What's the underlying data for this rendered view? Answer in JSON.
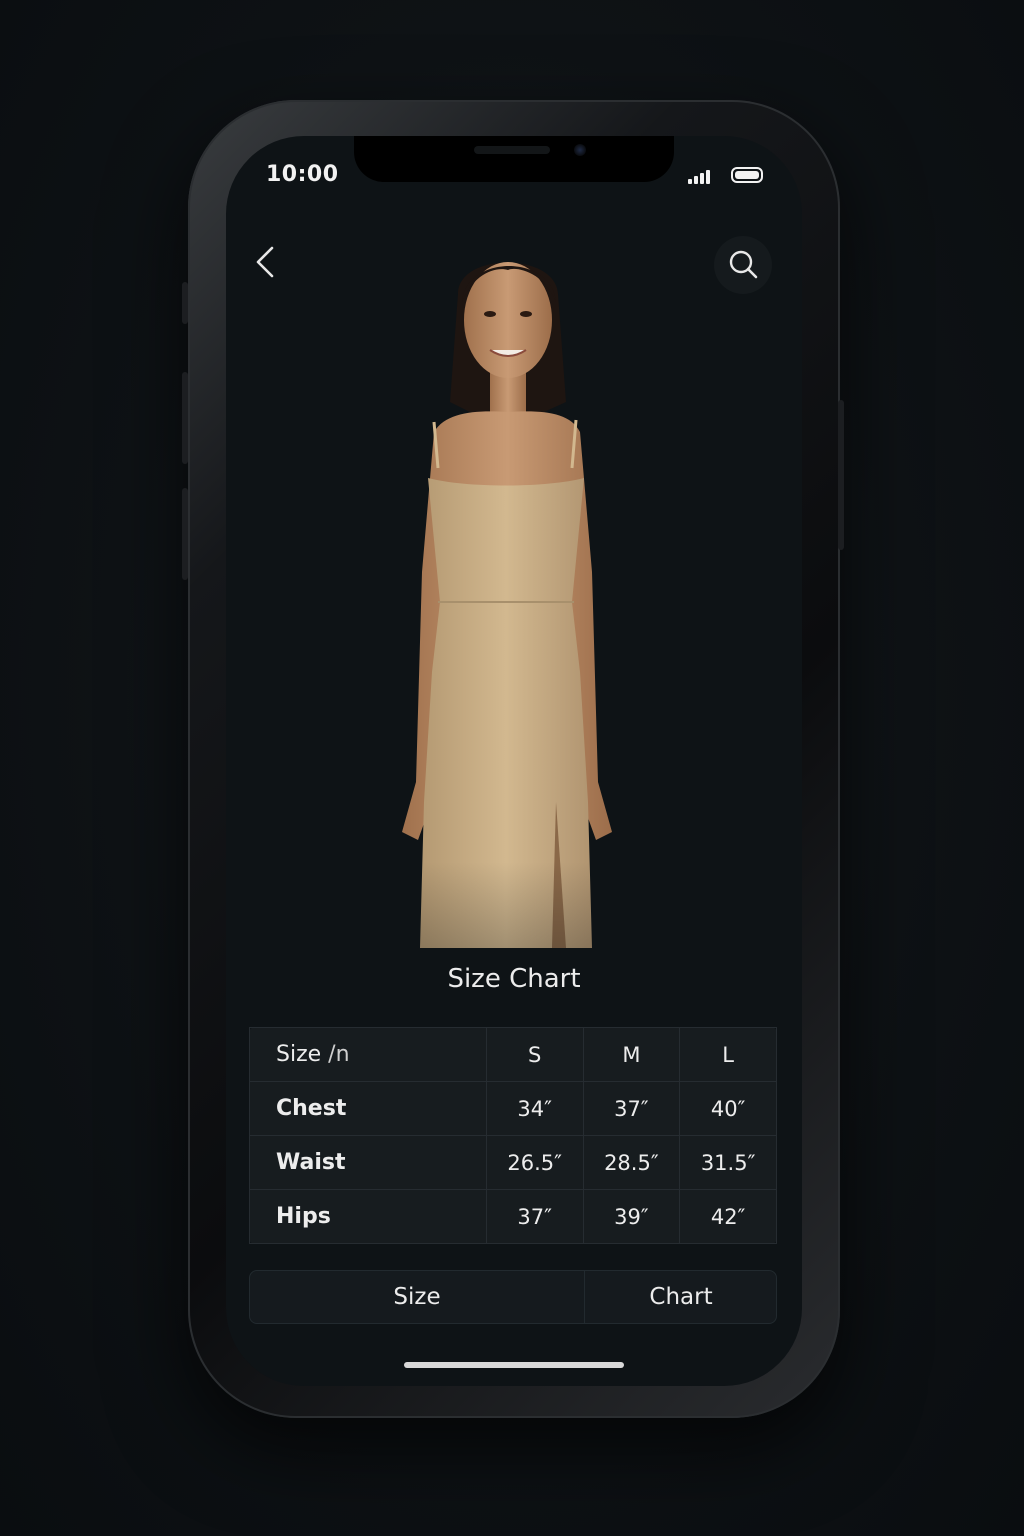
{
  "status_bar": {
    "time": "10:00"
  },
  "icons": {
    "back": "chevron-left-icon",
    "search": "search-icon",
    "signal": "signal-icon",
    "battery": "battery-icon"
  },
  "product_image": {
    "subject": "model-in-beige-slip-dress",
    "dress_color": "#c9ae86"
  },
  "size_chart": {
    "title": "Size Chart",
    "header": {
      "label": "Size",
      "label_suffix": "/n",
      "columns": [
        "S",
        "M",
        "L"
      ]
    },
    "rows": [
      {
        "label": "Chest",
        "values": [
          "34″",
          "37″",
          "40″"
        ]
      },
      {
        "label": "Waist",
        "values": [
          "26.5″",
          "28.5″",
          "31.5″"
        ]
      },
      {
        "label": "Hips",
        "values": [
          "37″",
          "39″",
          "42″"
        ]
      }
    ]
  },
  "tabs": [
    {
      "label": "Size"
    },
    {
      "label": "Chart"
    }
  ],
  "colors": {
    "background": "#0e1316",
    "text": "#ececec",
    "table_bg": "#181d21"
  }
}
